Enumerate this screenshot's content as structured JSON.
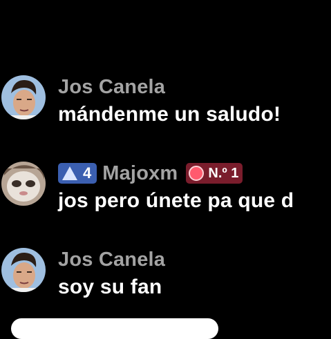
{
  "comments": [
    {
      "username": "Jos Canela",
      "message": "mándenme un saludo!"
    },
    {
      "username": "Majoxm",
      "message": "jos pero únete pa que d",
      "level": "4",
      "rank": "N.º 1"
    },
    {
      "username": "Jos Canela",
      "message": "soy su fan"
    }
  ],
  "colors": {
    "background": "#000000",
    "username": "#a3a3a3",
    "message": "#ffffff",
    "level_badge": "#3b5fb0",
    "rank_badge": "#7a1d2c"
  },
  "icons": {
    "level": "level-triangle-icon",
    "rank": "medal-icon"
  }
}
